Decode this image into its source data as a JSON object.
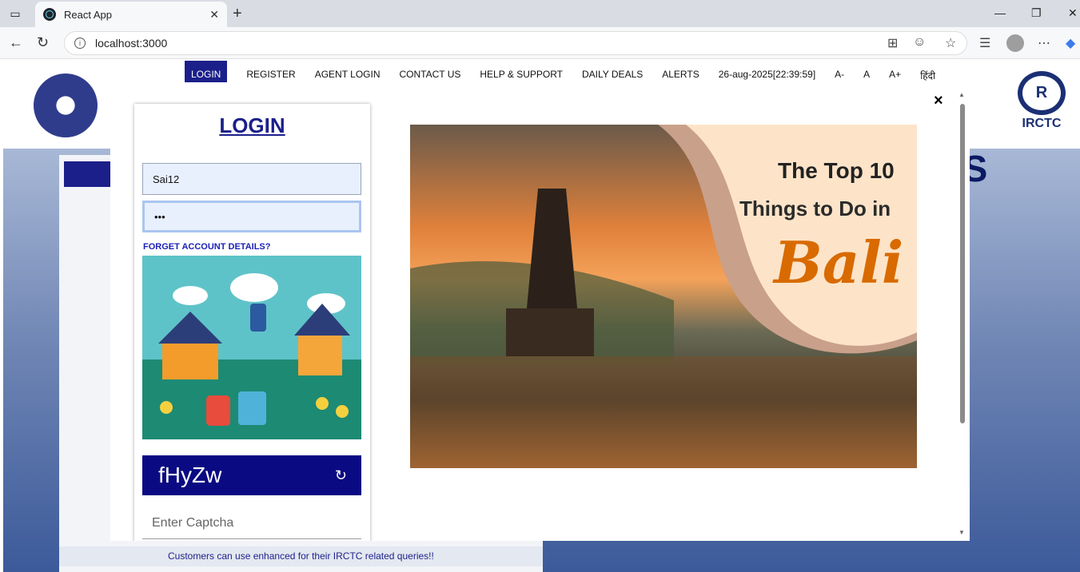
{
  "browser": {
    "tab_title": "React App",
    "url": "localhost:3000"
  },
  "site": {
    "nav": [
      "LOGIN",
      "REGISTER",
      "AGENT LOGIN",
      "CONTACT US",
      "HELP & SUPPORT",
      "DAILY DEALS",
      "ALERTS",
      "26-aug-2025[22:39:59]",
      "A-",
      "A",
      "A+",
      "हिंदी"
    ],
    "irctc_logo_text": "IRCTC",
    "hero_title_fragment": "YS",
    "footer_notice": "Customers can use enhanced for their IRCTC related queries!!"
  },
  "modal": {
    "close_label": "×",
    "login": {
      "title": "LOGIN",
      "username_value": "Sai12",
      "password_value": "•••",
      "forgot_label": "FORGET ACCOUNT DETAILS?",
      "captcha_text": "fHyZw",
      "refresh_icon": "↻",
      "captcha_placeholder": "Enter Captcha"
    },
    "banner": {
      "line1": "The Top 10",
      "line2": "Things to Do in",
      "line3": "Bali"
    }
  }
}
